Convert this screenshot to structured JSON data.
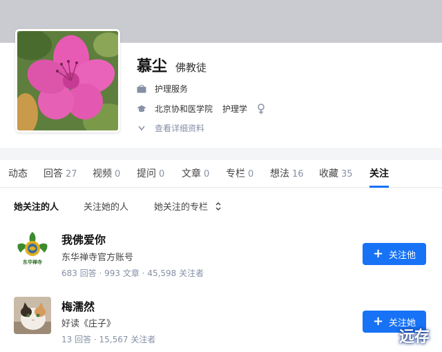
{
  "profile": {
    "name": "慕尘",
    "headline": "佛教徒",
    "job": "护理服务",
    "school": "北京协和医学院",
    "major": "护理学",
    "gender_icon": "female-icon",
    "more_link": "查看详细资料"
  },
  "tabs": [
    {
      "label": "动态",
      "count": ""
    },
    {
      "label": "回答",
      "count": "27"
    },
    {
      "label": "视频",
      "count": "0"
    },
    {
      "label": "提问",
      "count": "0"
    },
    {
      "label": "文章",
      "count": "0"
    },
    {
      "label": "专栏",
      "count": "0"
    },
    {
      "label": "想法",
      "count": "16"
    },
    {
      "label": "收藏",
      "count": "35"
    },
    {
      "label": "关注",
      "count": ""
    }
  ],
  "active_tab": "关注",
  "subtabs": [
    "她关注的人",
    "关注她的人",
    "她关注的专栏"
  ],
  "users": [
    {
      "name": "我佛爱你",
      "bio": "东华禅寺官方账号",
      "stats": "683 回答 · 993 文章 · 45,598 关注者",
      "button": "关注他",
      "avatar_text": "东华禅寺"
    },
    {
      "name": "梅濡然",
      "bio": "好读《庄子》",
      "stats": "13 回答 · 15,567 关注者",
      "button": "关注她"
    }
  ],
  "watermark": "远存",
  "colors": {
    "accent": "#1772f6",
    "muted": "#8590a6",
    "cover": "#c9cbd0"
  }
}
